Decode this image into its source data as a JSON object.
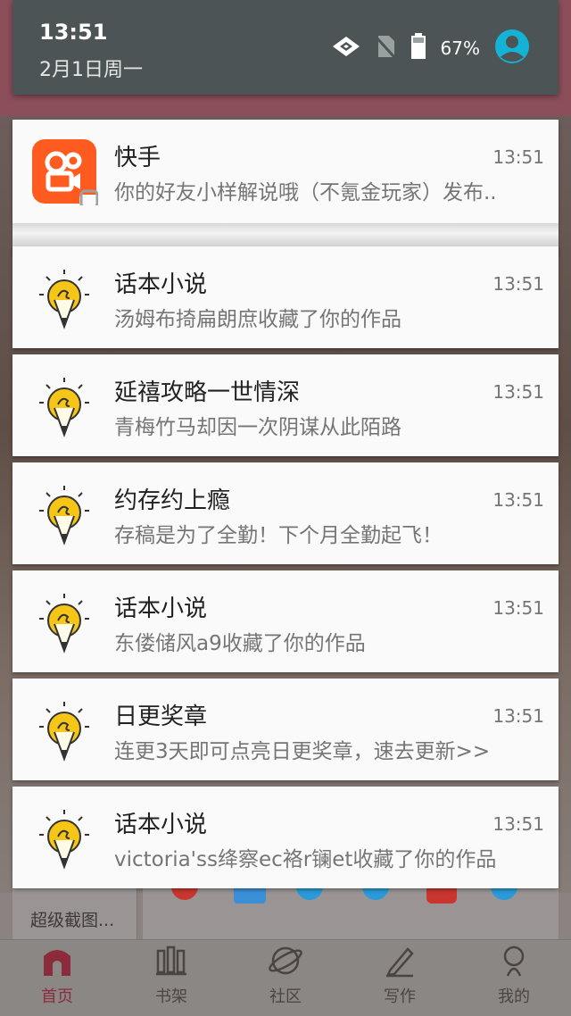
{
  "status_bar": {
    "time": "13:51",
    "date": "2月1日周一",
    "battery": "67%",
    "icons": [
      "wifi-icon",
      "no-sim-icon",
      "battery-icon",
      "account-icon"
    ]
  },
  "notifications": [
    {
      "app": "快手",
      "text": "你的好友小样解说哦（不氪金玩家）发布..",
      "time": "13:51",
      "icon": "kuaishou-app-icon"
    },
    {
      "app": "话本小说",
      "text": "汤姆布掎扁朗庶收藏了你的作品",
      "time": "13:51",
      "icon": "huaben-app-icon"
    },
    {
      "app": "延禧攻略一世情深",
      "text": "青梅竹马却因一次阴谋从此陌路",
      "time": "13:51",
      "icon": "huaben-app-icon"
    },
    {
      "app": "约存约上瘾",
      "text": "存稿是为了全勤！下个月全勤起飞！",
      "time": "13:51",
      "icon": "huaben-app-icon"
    },
    {
      "app": "话本小说",
      "text": "东偻储风a9收藏了你的作品",
      "time": "13:51",
      "icon": "huaben-app-icon"
    },
    {
      "app": "日更奖章",
      "text": "连更3天即可点亮日更奖章，速去更新>>",
      "time": "13:51",
      "icon": "huaben-app-icon"
    },
    {
      "app": "话本小说",
      "text": "victoria'ss绛察ec袼r镧et收藏了你的作品",
      "time": "13:51",
      "icon": "huaben-app-icon"
    }
  ],
  "background": {
    "screenshot_label": "超级截图...",
    "nav": [
      {
        "label": "首页",
        "icon": "home-icon",
        "active": true
      },
      {
        "label": "书架",
        "icon": "bookshelf-icon",
        "active": false
      },
      {
        "label": "社区",
        "icon": "community-icon",
        "active": false
      },
      {
        "label": "写作",
        "icon": "pen-icon",
        "active": false
      },
      {
        "label": "我的",
        "icon": "profile-icon",
        "active": false
      }
    ]
  },
  "colors": {
    "shade_bg": "#4c5455",
    "kuaishou_orange": "#ff5a1f",
    "bulb_yellow": "#f5c518",
    "account_cyan": "#14b3d6",
    "nav_active": "#8c2b3c"
  }
}
